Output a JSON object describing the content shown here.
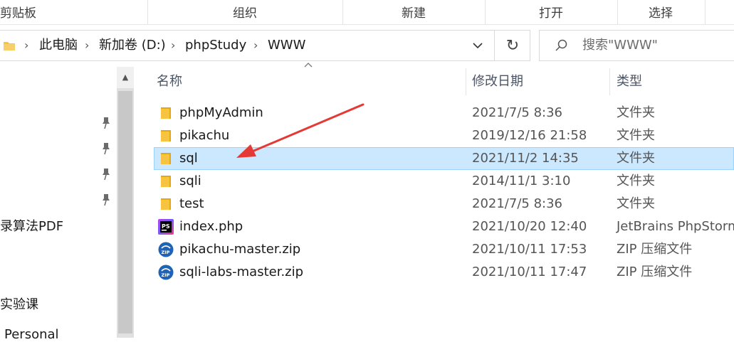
{
  "ribbon": {
    "groups": [
      "剪贴板",
      "组织",
      "新建",
      "打开",
      "选择"
    ]
  },
  "address_bar": {
    "crumbs": [
      "此电脑",
      "新加卷 (D:)",
      "phpStudy",
      "WWW"
    ],
    "folder_icon": "folder-icon",
    "dropdown_icon": "chevron-down-icon",
    "refresh_icon": "refresh-icon"
  },
  "search": {
    "placeholder": "搜索\"WWW\"",
    "icon": "search-icon"
  },
  "nav_pane": {
    "items": [
      "录算法PDF",
      "实验课",
      "Personal"
    ]
  },
  "columns": {
    "name": "名称",
    "date": "修改日期",
    "type": "类型"
  },
  "files": [
    {
      "name": "phpMyAdmin",
      "date": "2021/7/5 8:36",
      "type": "文件夹",
      "icon": "folder-icon",
      "selected": false
    },
    {
      "name": "pikachu",
      "date": "2019/12/16 21:58",
      "type": "文件夹",
      "icon": "folder-icon",
      "selected": false
    },
    {
      "name": "sql",
      "date": "2021/11/2 14:35",
      "type": "文件夹",
      "icon": "folder-icon",
      "selected": true
    },
    {
      "name": "sqli",
      "date": "2014/11/1 3:10",
      "type": "文件夹",
      "icon": "folder-icon",
      "selected": false
    },
    {
      "name": "test",
      "date": "2021/7/5 8:36",
      "type": "文件夹",
      "icon": "folder-icon",
      "selected": false
    },
    {
      "name": "index.php",
      "date": "2021/10/20 12:40",
      "type": "JetBrains PhpStorm",
      "icon": "phpstorm-icon",
      "selected": false
    },
    {
      "name": "pikachu-master.zip",
      "date": "2021/10/11 17:53",
      "type": "ZIP 压缩文件",
      "icon": "zip-icon",
      "selected": false
    },
    {
      "name": "sqli-labs-master.zip",
      "date": "2021/10/11 17:47",
      "type": "ZIP 压缩文件",
      "icon": "zip-icon",
      "selected": false
    }
  ],
  "annotation": {
    "color": "#e53935"
  },
  "colors": {
    "selection_bg": "#cce8ff",
    "selection_border": "#99d1ff",
    "folder_yellow": "#f6c343"
  }
}
